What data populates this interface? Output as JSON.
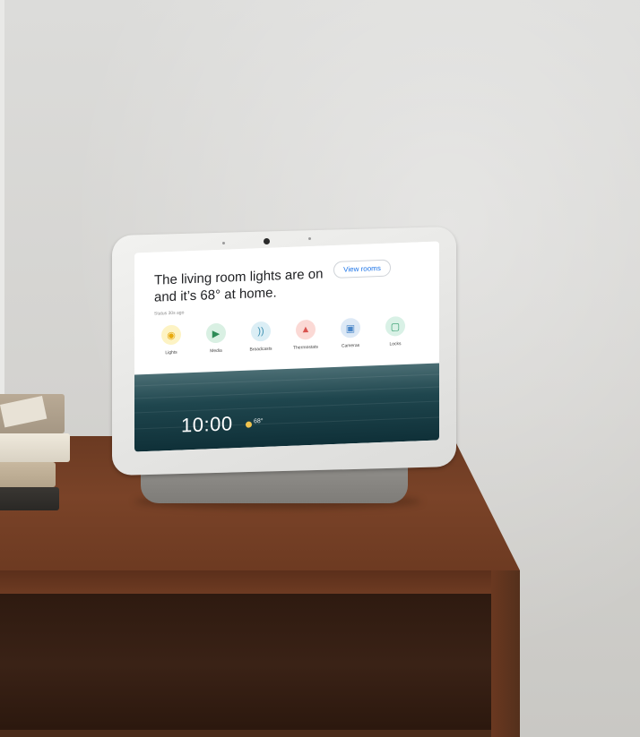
{
  "scene": "smart display on wooden cabinet",
  "display": {
    "headline_line1": "The living room lights are on",
    "headline_line2": "and it’s 68° at home.",
    "status": "Status 30s ago",
    "view_rooms": "View rooms",
    "tiles": [
      {
        "label": "Lights",
        "icon": "lightbulb-icon",
        "bg": "#fdf3c4",
        "color": "#e8a90b"
      },
      {
        "label": "Media",
        "icon": "play-icon",
        "bg": "#d9f0e3",
        "color": "#2e8b57"
      },
      {
        "label": "Broadcasts",
        "icon": "broadcast-icon",
        "bg": "#dbeef5",
        "color": "#3b8fb0"
      },
      {
        "label": "Thermostats",
        "icon": "thermometer-icon",
        "bg": "#fbd9d5",
        "color": "#d9534f"
      },
      {
        "label": "Cameras",
        "icon": "camera-icon",
        "bg": "#dde9f6",
        "color": "#4a86c8"
      },
      {
        "label": "Locks",
        "icon": "lock-icon",
        "bg": "#d9f1e6",
        "color": "#2e9a6a"
      }
    ],
    "clock": "10:00",
    "temperature": "68°"
  }
}
